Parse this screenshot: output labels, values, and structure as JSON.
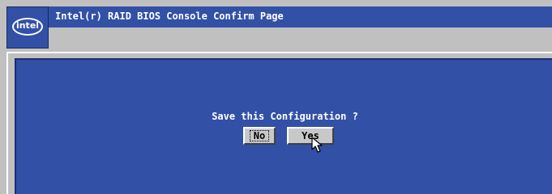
{
  "window": {
    "title": "Intel(r) RAID BIOS Console  Confirm Page",
    "logo_text": "intel"
  },
  "dialog": {
    "prompt": "Save this Configuration ?",
    "buttons": {
      "no_label": "No",
      "yes_label": "Yes"
    }
  },
  "colors": {
    "background": "#c0c0c0",
    "panel_blue": "#3250a6",
    "text_white": "#ffffff",
    "button_face": "#c8c8c8"
  },
  "icons": {
    "logo": "intel-logo-icon",
    "pointer": "mouse-pointer-icon"
  }
}
